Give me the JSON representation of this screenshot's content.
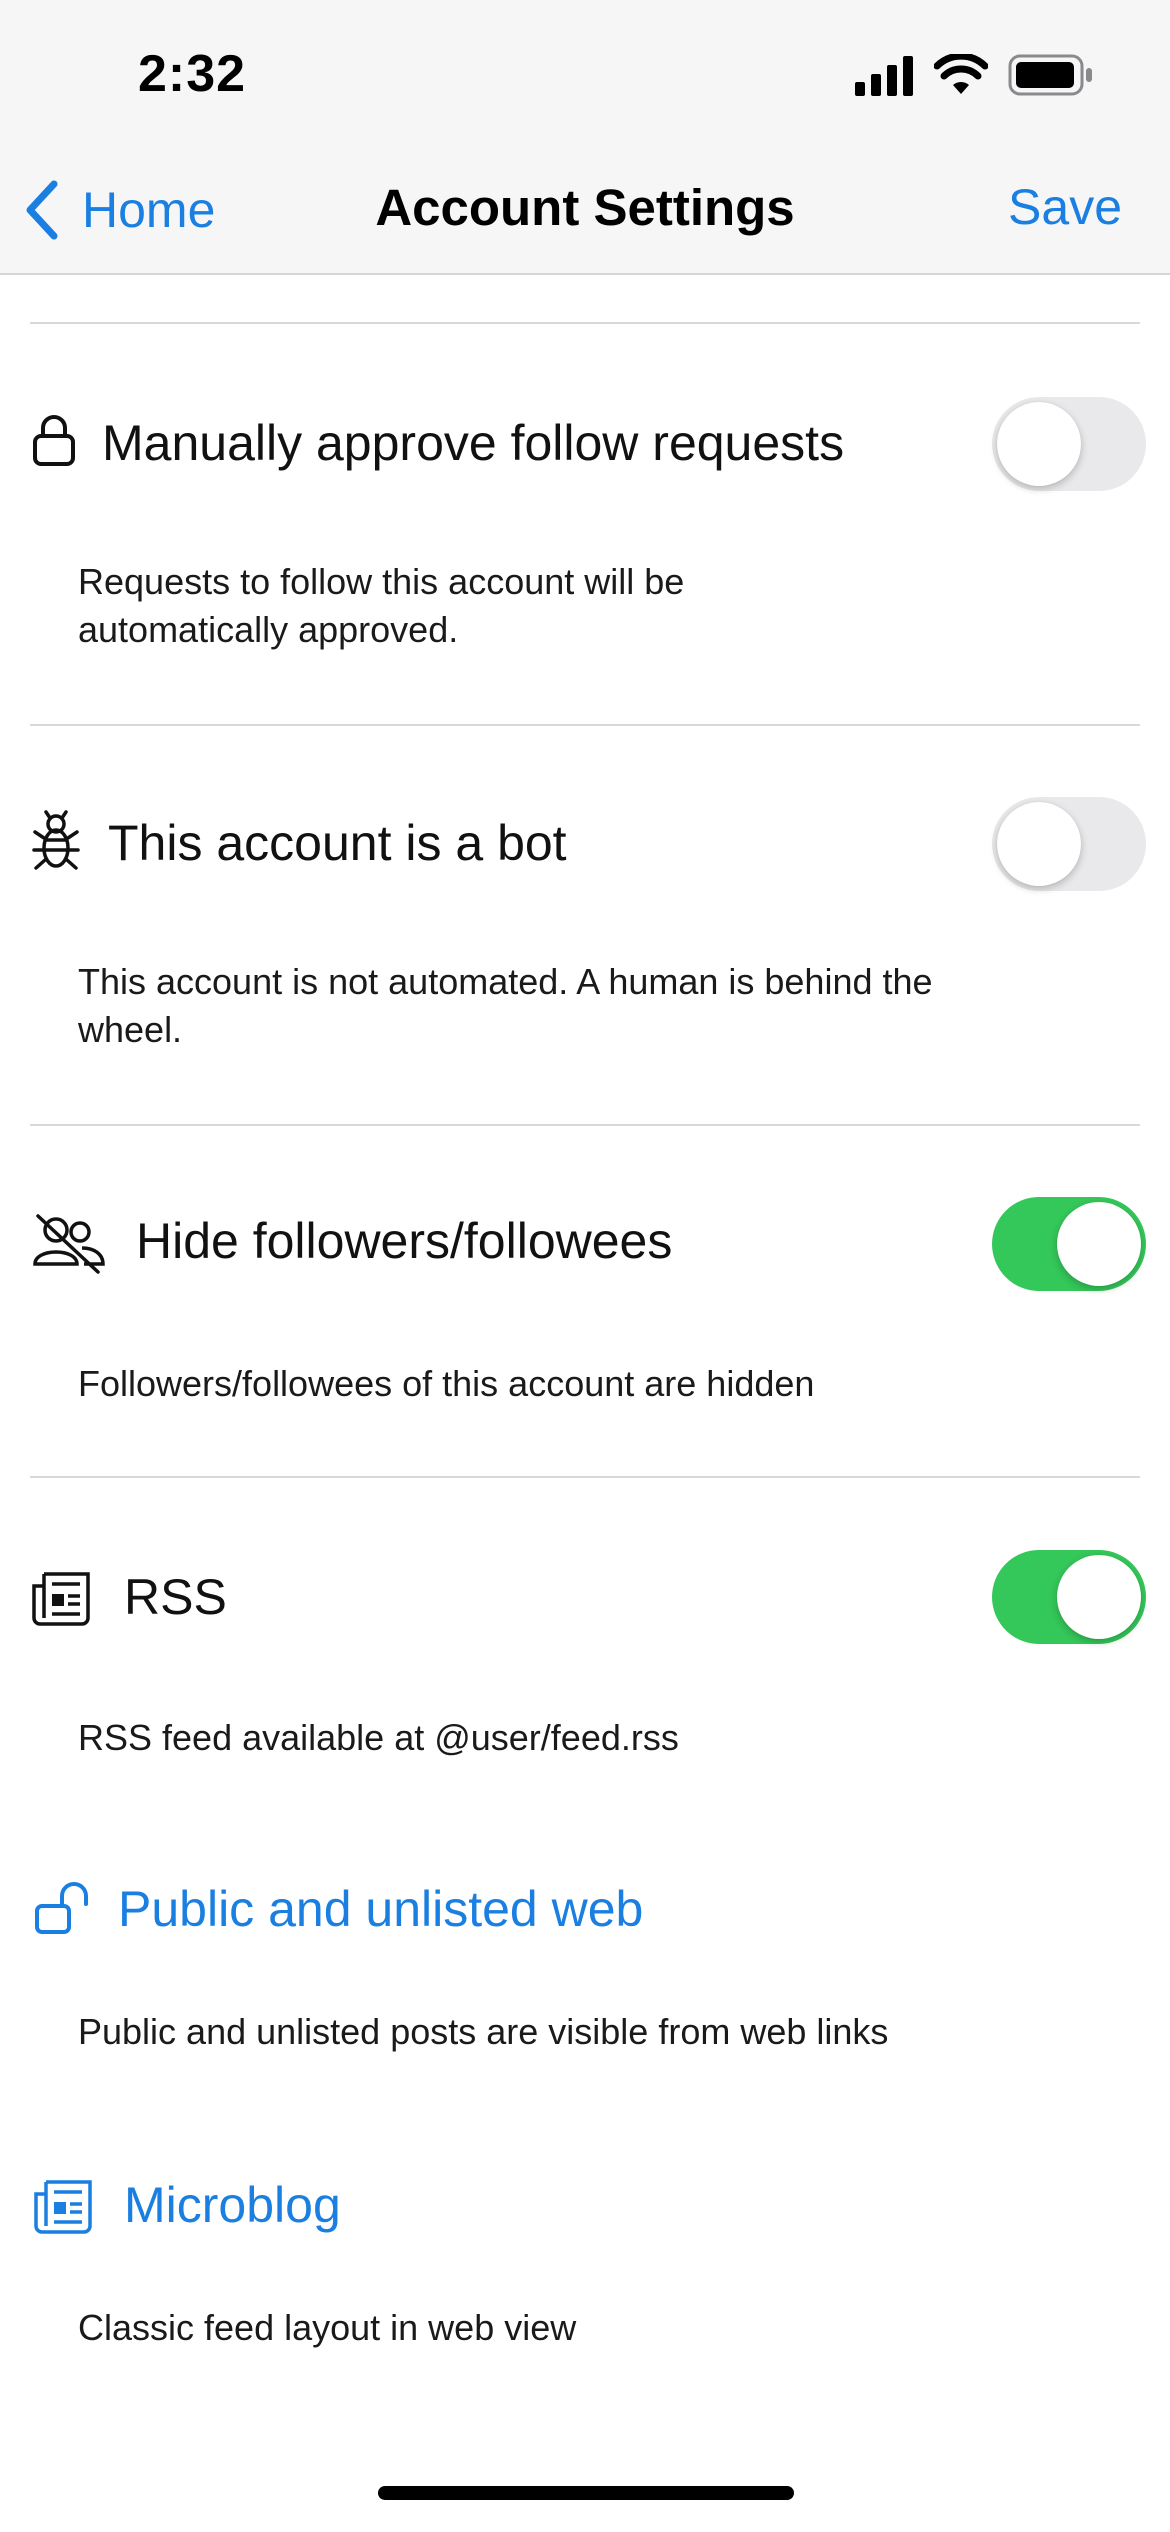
{
  "status_bar": {
    "time": "2:32"
  },
  "nav": {
    "back_label": "Home",
    "title": "Account Settings",
    "save_label": "Save"
  },
  "settings": [
    {
      "title": "Manually approve follow requests",
      "description": "Requests to follow this account will be automatically approved.",
      "icon": "lock-icon",
      "toggle": "off"
    },
    {
      "title": "This account is a bot",
      "description": "This account is not automated. A human is behind the wheel.",
      "icon": "bug-icon",
      "toggle": "off"
    },
    {
      "title": "Hide followers/followees",
      "description": "Followers/followees of this account are hidden",
      "icon": "hidden-users-icon",
      "toggle": "on"
    },
    {
      "title": "RSS",
      "description": "RSS feed available at @user/feed.rss",
      "icon": "newspaper-icon",
      "toggle": "on"
    }
  ],
  "links": [
    {
      "title": "Public and unlisted web",
      "description": "Public and unlisted posts are visible from web links",
      "icon": "unlock-icon"
    },
    {
      "title": "Microblog",
      "description": "Classic feed layout in web view",
      "icon": "newspaper-icon"
    }
  ],
  "colors": {
    "accent": "#1a7fe0",
    "toggle_on": "#34c759",
    "toggle_off": "#e9e9eb"
  }
}
